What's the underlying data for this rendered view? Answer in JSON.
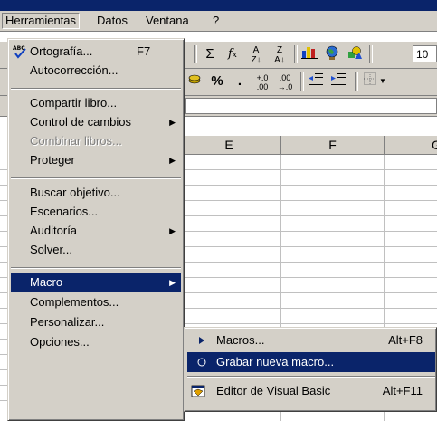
{
  "menubar": {
    "items": [
      {
        "label": "Herramientas"
      },
      {
        "label": "Datos"
      },
      {
        "label": "Ventana"
      },
      {
        "label": "?"
      }
    ]
  },
  "toolbar": {
    "font_size": "10"
  },
  "columns": [
    "E",
    "F",
    "G"
  ],
  "tools_menu": {
    "items": [
      {
        "label": "Ortografía...",
        "accel": "F7",
        "icon": "spelling-abc-icon"
      },
      {
        "label": "Autocorrección..."
      },
      {
        "label": "Compartir libro..."
      },
      {
        "label": "Control de cambios"
      },
      {
        "label": "Combinar libros..."
      },
      {
        "label": "Proteger"
      },
      {
        "label": "Buscar objetivo..."
      },
      {
        "label": "Escenarios..."
      },
      {
        "label": "Auditoría"
      },
      {
        "label": "Solver..."
      },
      {
        "label": "Macro"
      },
      {
        "label": "Complementos..."
      },
      {
        "label": "Personalizar..."
      },
      {
        "label": "Opciones..."
      }
    ]
  },
  "macro_submenu": {
    "items": [
      {
        "label": "Macros...",
        "accel": "Alt+F8",
        "icon": "play-triangle-icon"
      },
      {
        "label": "Grabar nueva macro...",
        "icon": "record-dot-icon"
      },
      {
        "label": "Editor de Visual Basic",
        "accel": "Alt+F11",
        "icon": "vb-editor-icon"
      }
    ]
  },
  "colors": {
    "highlight": "#0a246a",
    "face": "#d4d0c8",
    "disabled": "#808080"
  }
}
